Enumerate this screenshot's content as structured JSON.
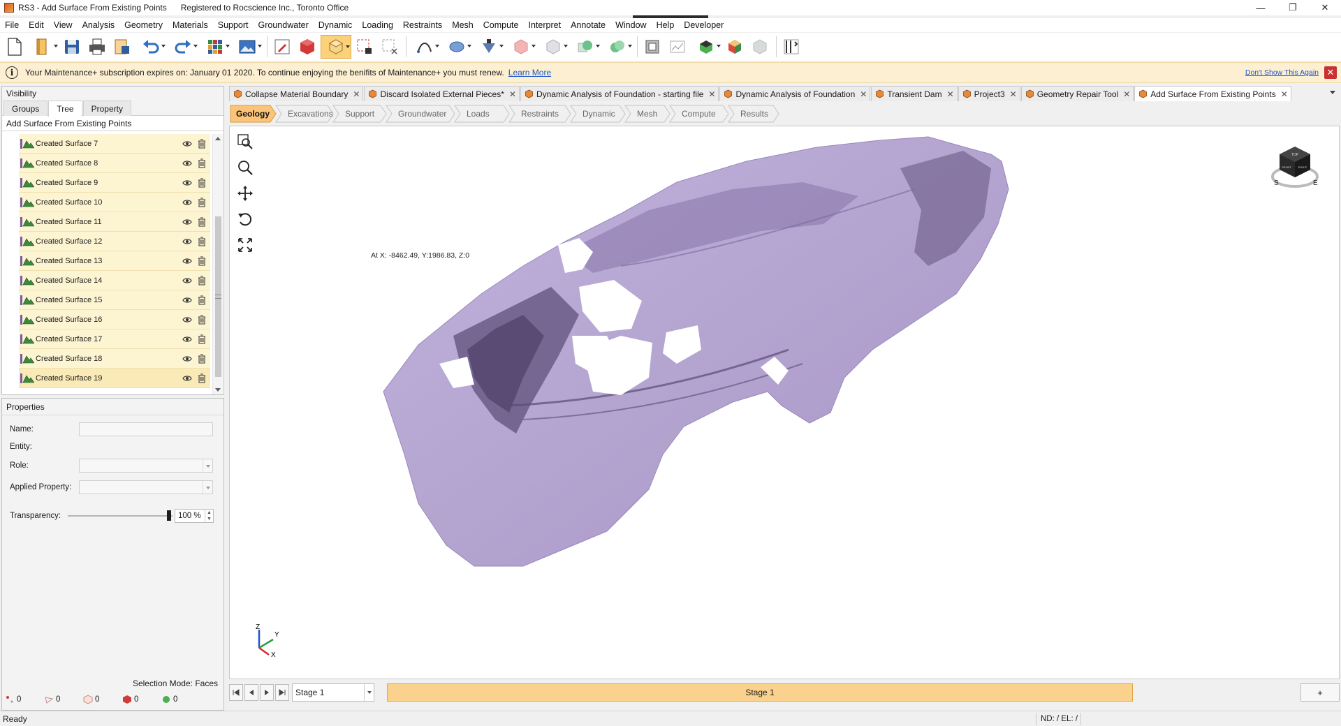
{
  "window": {
    "title": "RS3 - Add Surface From Existing Points",
    "registration": "Registered to Rocscience Inc., Toronto Office",
    "minimize": "—",
    "maximize": "❐",
    "close": "✕"
  },
  "menu": [
    "File",
    "Edit",
    "View",
    "Analysis",
    "Geometry",
    "Materials",
    "Support",
    "Groundwater",
    "Dynamic",
    "Loading",
    "Restraints",
    "Mesh",
    "Compute",
    "Interpret",
    "Annotate",
    "Window",
    "Help",
    "Developer"
  ],
  "notification": {
    "message": "Your Maintenance+ subscription expires on: January 01 2020. To continue enjoying the benifits of Maintenance+ you must renew.",
    "link": "Learn More",
    "dont_show": "Don't Show This Again"
  },
  "visibility_panel": {
    "title": "Visibility",
    "tabs": [
      "Groups",
      "Tree",
      "Property"
    ],
    "active_tab": "Tree",
    "tree_header": "Add Surface From Existing Points",
    "items": [
      "Created Surface 7",
      "Created Surface 8",
      "Created Surface 9",
      "Created Surface 10",
      "Created Surface 11",
      "Created Surface 12",
      "Created Surface 13",
      "Created Surface 14",
      "Created Surface 15",
      "Created Surface 16",
      "Created Surface 17",
      "Created Surface 18",
      "Created Surface 19"
    ]
  },
  "properties_panel": {
    "title": "Properties",
    "name_label": "Name:",
    "entity_label": "Entity:",
    "role_label": "Role:",
    "applied_property_label": "Applied Property:",
    "transparency_label": "Transparency:",
    "transparency_value": "100 %",
    "transparency_level": 100,
    "selection_mode": "Selection Mode: Faces",
    "counts": [
      "0",
      "0",
      "0",
      "0",
      "0"
    ]
  },
  "document_tabs": [
    "Collapse Material Boundary",
    "Discard Isolated External Pieces*",
    "Dynamic Analysis of Foundation - starting file",
    "Dynamic Analysis of Foundation",
    "Transient Dam",
    "Project3",
    "Geometry Repair Tool",
    "Add Surface From Existing Points"
  ],
  "active_document_tab": "Add Surface From Existing Points",
  "workflow_tabs": [
    "Geology",
    "Excavations",
    "Support",
    "Groundwater",
    "Loads",
    "Restraints",
    "Dynamic",
    "Mesh",
    "Compute",
    "Results"
  ],
  "active_workflow_tab": "Geology",
  "viewport": {
    "coordinates": "At X: -8462.49, Y:1986.83, Z:0",
    "mesh_color": "#b6a6d2",
    "navcube_labels": [
      "TOP",
      "FRONT",
      "RIGHT",
      "S",
      "E"
    ],
    "axis_labels": [
      "Z",
      "Y",
      "X"
    ]
  },
  "stage_bar": {
    "stage_select": "Stage 1",
    "stage_tab": "Stage 1",
    "add_label": "+"
  },
  "status_bar": {
    "ready": "Ready",
    "nd_el": "ND: /   EL: /"
  },
  "colors": {
    "accent": "#fbd18e",
    "tree_row": "#fdf4d2",
    "notification_bg": "#fdf0d2",
    "link": "#1a55c8"
  }
}
